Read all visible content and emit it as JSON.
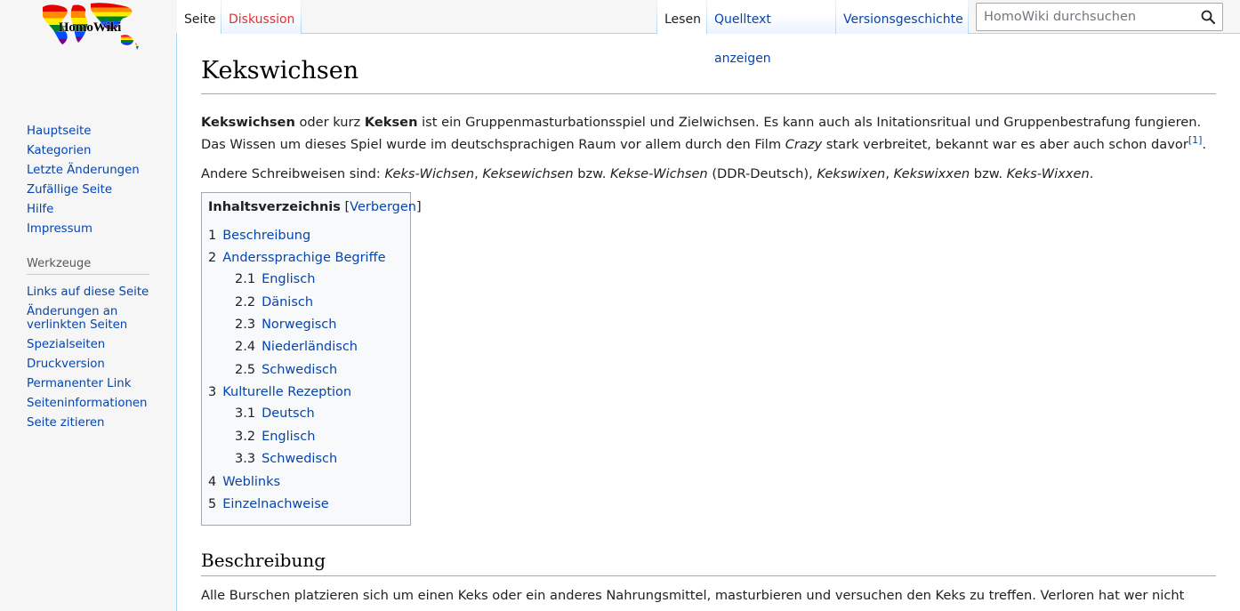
{
  "logo": {
    "text": "HomoWiki"
  },
  "sidebar": {
    "navigation": [
      "Hauptseite",
      "Kategorien",
      "Letzte Änderungen",
      "Zufällige Seite",
      "Hilfe",
      "Impressum"
    ],
    "tools_heading": "Werkzeuge",
    "tools": [
      "Links auf diese Seite",
      "Änderungen an verlinkten Seiten",
      "Spezialseiten",
      "Druckversion",
      "Permanenter Link",
      "Seiteninformationen",
      "Seite zitieren"
    ]
  },
  "tabs": {
    "page": "Seite",
    "discussion": "Diskussion",
    "read": "Lesen",
    "view_source": "Quelltext anzeigen",
    "history": "Versionsgeschichte"
  },
  "search": {
    "placeholder": "HomoWiki durchsuchen"
  },
  "article": {
    "title": "Kekswichsen",
    "intro_bold1": "Kekswichsen",
    "intro_t1": " oder kurz ",
    "intro_bold2": "Keksen",
    "intro_t2": " ist ein Gruppenmasturbationsspiel und Zielwichsen. Es kann auch als Initationsritual und Gruppenbestrafung fungieren. Das Wissen um dieses Spiel wurde im deutschsprachigen Raum vor allem durch den Film ",
    "intro_film": "Crazy",
    "intro_t3": " stark verbreitet, bekannt war es aber auch schon davor",
    "intro_ref": "[1]",
    "intro_end": ".",
    "alt_prefix": "Andere Schreibweisen sind: ",
    "alt_1": "Keks-Wichsen",
    "sep_comma": ", ",
    "alt_2": "Keksewichsen",
    "bzw": " bzw. ",
    "alt_3": "Kekse-Wichsen",
    "alt_3_note": " (DDR-Deutsch), ",
    "alt_4": "Kekswixen",
    "alt_5": "Kekswixxen",
    "alt_6": "Keks-Wixxen",
    "alt_end": ".",
    "section1_heading": "Beschreibung",
    "section1_text": "Alle Burschen platzieren sich um einen Keks oder ein anderes Nahrungsmittel, masturbieren und versuchen den Keks zu treffen. Verloren hat wer nicht"
  },
  "toc": {
    "heading": "Inhaltsverzeichnis",
    "toggle_open": "[",
    "toggle": "Verbergen",
    "toggle_close": "]",
    "items": [
      {
        "num": "1",
        "label": "Beschreibung",
        "level": 1
      },
      {
        "num": "2",
        "label": "Anderssprachige Begriffe",
        "level": 1
      },
      {
        "num": "2.1",
        "label": "Englisch",
        "level": 2
      },
      {
        "num": "2.2",
        "label": "Dänisch",
        "level": 2
      },
      {
        "num": "2.3",
        "label": "Norwegisch",
        "level": 2
      },
      {
        "num": "2.4",
        "label": "Niederländisch",
        "level": 2
      },
      {
        "num": "2.5",
        "label": "Schwedisch",
        "level": 2
      },
      {
        "num": "3",
        "label": "Kulturelle Rezeption",
        "level": 1
      },
      {
        "num": "3.1",
        "label": "Deutsch",
        "level": 2
      },
      {
        "num": "3.2",
        "label": "Englisch",
        "level": 2
      },
      {
        "num": "3.3",
        "label": "Schwedisch",
        "level": 2
      },
      {
        "num": "4",
        "label": "Weblinks",
        "level": 1
      },
      {
        "num": "5",
        "label": "Einzelnachweise",
        "level": 1
      }
    ]
  }
}
